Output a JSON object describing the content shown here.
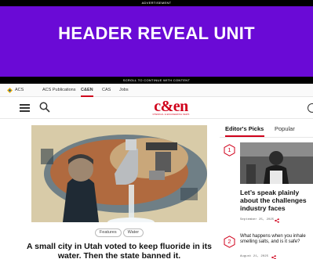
{
  "ad": {
    "label": "ADVERTISEMENT",
    "headline": "HEADER REVEAL UNIT",
    "scroll_text": "SCROLL TO CONTINUE WITH CONTENT",
    "background": "#6a0ad6"
  },
  "acs_bar": {
    "items": [
      {
        "label": "ACS",
        "icon": "acs-logo-icon"
      },
      {
        "label": "ACS Publications"
      },
      {
        "label": "C&EN",
        "active": true
      },
      {
        "label": "CAS"
      },
      {
        "label": "Jobs"
      }
    ]
  },
  "nav": {
    "logo_text": "c&en",
    "logo_tagline": "CHEMICAL & ENGINEERING NEWS",
    "menu_icon": "hamburger-menu-icon",
    "search_icon": "search-icon",
    "user_icon": "user-account-icon",
    "brand_color": "#d0011b"
  },
  "lead_story": {
    "tags": [
      "Features",
      "Water"
    ],
    "headline": "A small city in Utah voted to keep fluoride in its water. Then the state banned it."
  },
  "rail": {
    "tabs": [
      "Editor's Picks",
      "Popular"
    ],
    "items": [
      {
        "rank": "1",
        "title": "Let’s speak plainly about the challenges industry faces",
        "date": "September 25, 2025"
      },
      {
        "rank": "2",
        "title": "What happens when you inhale smelling salts, and is it safe?",
        "date": "August 21, 2025"
      }
    ]
  }
}
